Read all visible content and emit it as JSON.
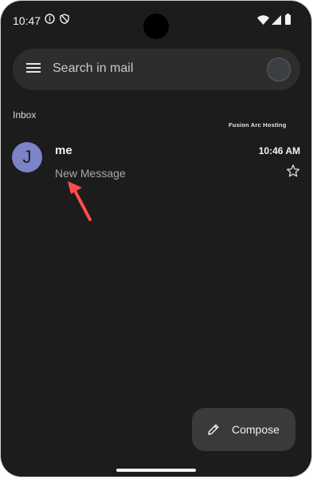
{
  "status_bar": {
    "time": "10:47",
    "icons": [
      "info-icon",
      "shield-icon",
      "wifi-icon",
      "signal-icon",
      "battery-icon"
    ]
  },
  "search": {
    "placeholder": "Search in mail"
  },
  "inbox": {
    "label": "Inbox",
    "watermark": "Fusion Arc Hosting",
    "emails": [
      {
        "avatar_letter": "J",
        "sender": "me",
        "time": "10:46 AM",
        "subject": "New Message",
        "starred": false
      }
    ]
  },
  "fab": {
    "label": "Compose"
  },
  "colors": {
    "background": "#1c1c1c",
    "search_bg": "#2d2d2d",
    "avatar": "#7b84c8",
    "arrow": "#ff4d4d"
  }
}
